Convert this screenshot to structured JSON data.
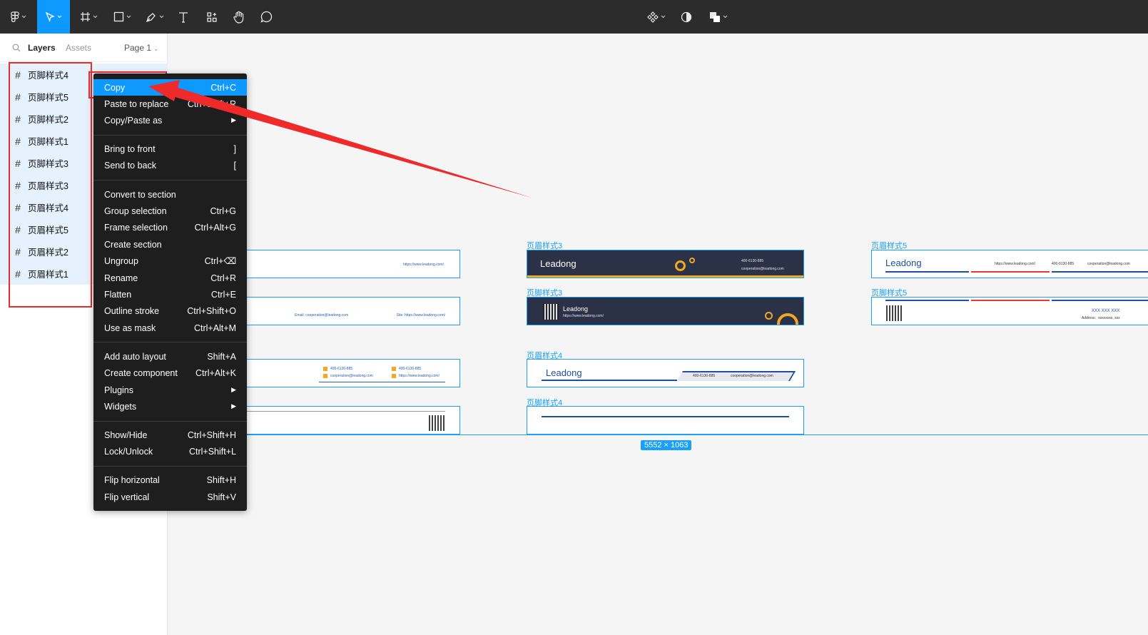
{
  "toolbar": {
    "tools": [
      {
        "name": "main-menu",
        "icon": "figma-logo-icon"
      },
      {
        "name": "move-tool",
        "icon": "cursor-arrow-icon",
        "active": true
      },
      {
        "name": "frame-tool",
        "icon": "hash-frame-icon"
      },
      {
        "name": "shape-tool",
        "icon": "rectangle-icon"
      },
      {
        "name": "pen-tool",
        "icon": "pen-icon"
      },
      {
        "name": "text-tool",
        "icon": "text-t-icon"
      },
      {
        "name": "resources-tool",
        "icon": "resources-icon"
      },
      {
        "name": "hand-tool",
        "icon": "hand-icon"
      },
      {
        "name": "comment-tool",
        "icon": "comment-bubble-icon"
      }
    ],
    "right_tools": [
      {
        "name": "components",
        "icon": "components-diamond-icon"
      },
      {
        "name": "contrast",
        "icon": "half-circle-icon"
      },
      {
        "name": "boolean-ops",
        "icon": "boolean-squares-icon"
      }
    ]
  },
  "panel": {
    "tabs": {
      "layers": "Layers",
      "assets": "Assets",
      "page": "Page 1"
    },
    "layers": [
      "页脚样式4",
      "页脚样式5",
      "页脚样式2",
      "页脚样式1",
      "页脚样式3",
      "页眉样式3",
      "页眉样式4",
      "页眉样式5",
      "页眉样式2",
      "页眉样式1"
    ]
  },
  "context_menu": {
    "groups": [
      [
        {
          "label": "Copy",
          "shortcut": "Ctrl+C",
          "highlighted": true
        },
        {
          "label": "Paste to replace",
          "shortcut": "Ctrl+Shift+R"
        },
        {
          "label": "Copy/Paste as",
          "shortcut": "▶"
        }
      ],
      [
        {
          "label": "Bring to front",
          "shortcut": "]"
        },
        {
          "label": "Send to back",
          "shortcut": "["
        }
      ],
      [
        {
          "label": "Convert to section",
          "shortcut": ""
        },
        {
          "label": "Group selection",
          "shortcut": "Ctrl+G"
        },
        {
          "label": "Frame selection",
          "shortcut": "Ctrl+Alt+G"
        },
        {
          "label": "Create section",
          "shortcut": ""
        },
        {
          "label": "Ungroup",
          "shortcut": "Ctrl+⌫"
        },
        {
          "label": "Rename",
          "shortcut": "Ctrl+R"
        },
        {
          "label": "Flatten",
          "shortcut": "Ctrl+E"
        },
        {
          "label": "Outline stroke",
          "shortcut": "Ctrl+Shift+O"
        },
        {
          "label": "Use as mask",
          "shortcut": "Ctrl+Alt+M"
        }
      ],
      [
        {
          "label": "Add auto layout",
          "shortcut": "Shift+A"
        },
        {
          "label": "Create component",
          "shortcut": "Ctrl+Alt+K"
        },
        {
          "label": "Plugins",
          "shortcut": "▶"
        },
        {
          "label": "Widgets",
          "shortcut": "▶"
        }
      ],
      [
        {
          "label": "Show/Hide",
          "shortcut": "Ctrl+Shift+H"
        },
        {
          "label": "Lock/Unlock",
          "shortcut": "Ctrl+Shift+L"
        }
      ],
      [
        {
          "label": "Flip horizontal",
          "shortcut": "Shift+H"
        },
        {
          "label": "Flip vertical",
          "shortcut": "Shift+V"
        }
      ]
    ]
  },
  "canvas": {
    "frame_labels": {
      "h3": "页眉样式3",
      "f3": "页脚样式3",
      "h4": "页眉样式4",
      "f4": "页脚样式4",
      "h5": "页眉样式5",
      "f5": "页脚样式5"
    },
    "brand": "Leadong",
    "url": "https://www.leadong.com/",
    "email_line": "Email: cooperation@leadong.com",
    "site_line": "Site: https://www.leadong.com/",
    "phone": "400-6130-885",
    "email": "cooperation@leadong.com",
    "address": "Address：xxxxxxxx, xxx",
    "xxx_line": "XXX XXX XXX",
    "size_badge": "5552 × 1063"
  },
  "colors": {
    "accent": "#0d99ff",
    "frame_border": "#18a0fb",
    "annotation": "#ee2a2a",
    "dark_banner": "#2b3147",
    "orange": "#f2a91e",
    "brand_blue": "#1e4fa0"
  }
}
